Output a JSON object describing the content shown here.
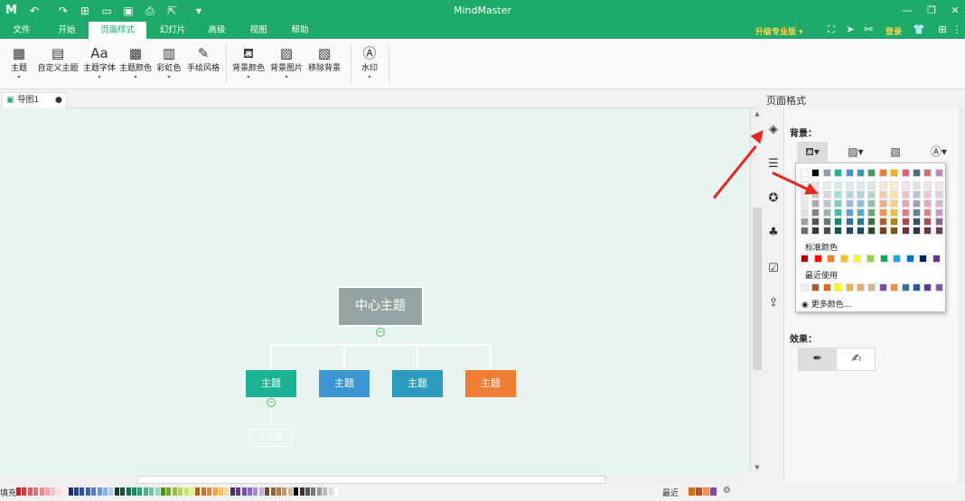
{
  "app": {
    "title": "MindMaster"
  },
  "titlebar": {
    "upgrade": "升级专业版",
    "login": "登录"
  },
  "menu": [
    {
      "label": "文件",
      "active": false
    },
    {
      "label": "开始",
      "active": false
    },
    {
      "label": "页面样式",
      "active": true
    },
    {
      "label": "幻灯片",
      "active": false
    },
    {
      "label": "高级",
      "active": false
    },
    {
      "label": "视图",
      "active": false
    },
    {
      "label": "帮助",
      "active": false
    }
  ],
  "ribbon": [
    {
      "label": "主题",
      "icon": "theme-grid-icon"
    },
    {
      "label": "自定义主题",
      "icon": "custom-theme-icon"
    },
    {
      "label": "主题字体",
      "icon": "font-icon"
    },
    {
      "label": "主题颜色",
      "icon": "theme-color-icon"
    },
    {
      "label": "彩虹色",
      "icon": "rainbow-icon"
    },
    {
      "label": "手绘风格",
      "icon": "hand-draw-icon"
    },
    {
      "label": "背景颜色",
      "icon": "paint-bucket-icon"
    },
    {
      "label": "背景图片",
      "icon": "background-image-icon"
    },
    {
      "label": "移除背景",
      "icon": "remove-background-icon"
    },
    {
      "label": "水印",
      "icon": "watermark-icon"
    }
  ],
  "document_tab": {
    "label": "导图1"
  },
  "mindmap": {
    "central": "中心主题",
    "topics": [
      "主题",
      "主题",
      "主题",
      "主题"
    ],
    "topic_colors": [
      "#1ab394",
      "#3a97d4",
      "#2b9cbf",
      "#ef7d33"
    ],
    "child": "子主题"
  },
  "bottom": {
    "fill_label": "填充",
    "recent_label": "最近"
  },
  "panel": {
    "title": "页面格式",
    "background_label": "背景：",
    "effect_label": "效果："
  },
  "picker": {
    "standard_label": "标准颜色",
    "recent_label": "最近使用",
    "more_label": "更多颜色...",
    "theme_row": [
      "#ffffff",
      "#000000",
      "#8f9da3",
      "#1ab394",
      "#3a97d4",
      "#2b9cbf",
      "#39a35a",
      "#ef7d33",
      "#f0b323",
      "#e85d75",
      "#4a6b8a",
      "#e56876",
      "#b888b8"
    ],
    "standard": [
      "#c00000",
      "#ff0000",
      "#f47b25",
      "#ffc000",
      "#ffff00",
      "#92d050",
      "#00b050",
      "#00b0f0",
      "#0070c0",
      "#002060",
      "#7030a0"
    ],
    "recent": [
      "#e6f4ec",
      "#b0562a",
      "#e0691d",
      "#ffff00",
      "#f2b43a",
      "#e8aa66",
      "#d9b38c",
      "#7b4ea0",
      "#e8944f",
      "#2e6fb5",
      "#1e5fa8",
      "#5c3a8a",
      "#7a5ba6"
    ]
  }
}
